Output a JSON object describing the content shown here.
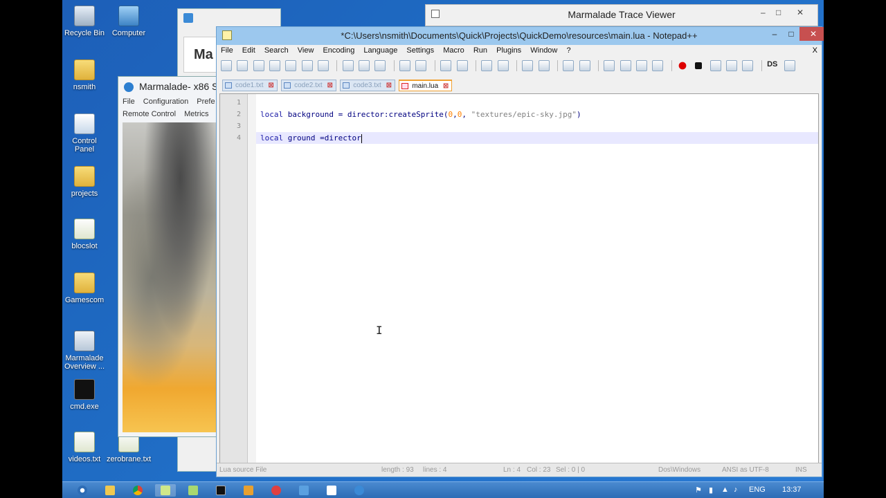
{
  "desktop": {
    "icons": [
      {
        "label": "Recycle Bin",
        "icon": "recycle-bin-icon"
      },
      {
        "label": "Computer",
        "icon": "computer-icon"
      },
      {
        "label": "nsmith",
        "icon": "user-folder-icon"
      },
      {
        "label": "Control Panel",
        "icon": "control-panel-icon"
      },
      {
        "label": "projects",
        "icon": "folder-icon"
      },
      {
        "label": "blocslot",
        "icon": "shortcut-icon"
      },
      {
        "label": "Gamescom",
        "icon": "folder-icon"
      },
      {
        "label": "Marmalade Overview ...",
        "icon": "marmalade-icon"
      },
      {
        "label": "cmd.exe",
        "icon": "cmd-icon"
      },
      {
        "label": "videos.txt",
        "icon": "text-file-icon"
      },
      {
        "label": "zerobrane.txt",
        "icon": "text-file-icon"
      }
    ]
  },
  "trace_viewer": {
    "title": "Marmalade Trace Viewer",
    "min": "–",
    "max": "□",
    "close": "✕"
  },
  "marmalade_back": {
    "heading": "Ma"
  },
  "simulator": {
    "title": "Marmalade- x86 Si",
    "menu_row1": [
      "File",
      "Configuration",
      "Prefe"
    ],
    "menu_row2": [
      "Remote Control",
      "Metrics"
    ]
  },
  "notepadpp": {
    "title": "*C:\\Users\\nsmith\\Documents\\Quick\\Projects\\QuickDemo\\resources\\main.lua - Notepad++",
    "min": "–",
    "max": "□",
    "close": "✕",
    "menu": [
      "File",
      "Edit",
      "Search",
      "View",
      "Encoding",
      "Language",
      "Settings",
      "Macro",
      "Run",
      "Plugins",
      "Window",
      "?"
    ],
    "menu_close": "X",
    "toolbar_ds": "DS",
    "tabs": [
      {
        "label": "code1.txt",
        "active": false
      },
      {
        "label": "code2.txt",
        "active": false
      },
      {
        "label": "code3.txt",
        "active": false
      },
      {
        "label": "main.lua",
        "active": true
      }
    ],
    "tab_close": "⊠",
    "line_numbers": [
      "1",
      "2",
      "3",
      "4"
    ],
    "code": {
      "line2": {
        "kw": "local",
        "a": " background = director:createSprite(",
        "n1": "0",
        "c1": ",",
        "n2": "0",
        "c2": ", ",
        "s": "\"textures/epic-sky.jpg\"",
        "e": ")"
      },
      "line4": {
        "kw": "local",
        "a": " ground =director"
      }
    },
    "status": {
      "file_type": "Lua source File",
      "length": "length : 93",
      "lines": "lines : 4",
      "ln": "Ln : 4",
      "col": "Col : 23",
      "sel": "Sel : 0 | 0",
      "eol": "Dos\\Windows",
      "encoding": "ANSI as UTF-8",
      "mode": "INS"
    }
  },
  "taskbar": {
    "lang": "ENG",
    "time": "13:37"
  }
}
